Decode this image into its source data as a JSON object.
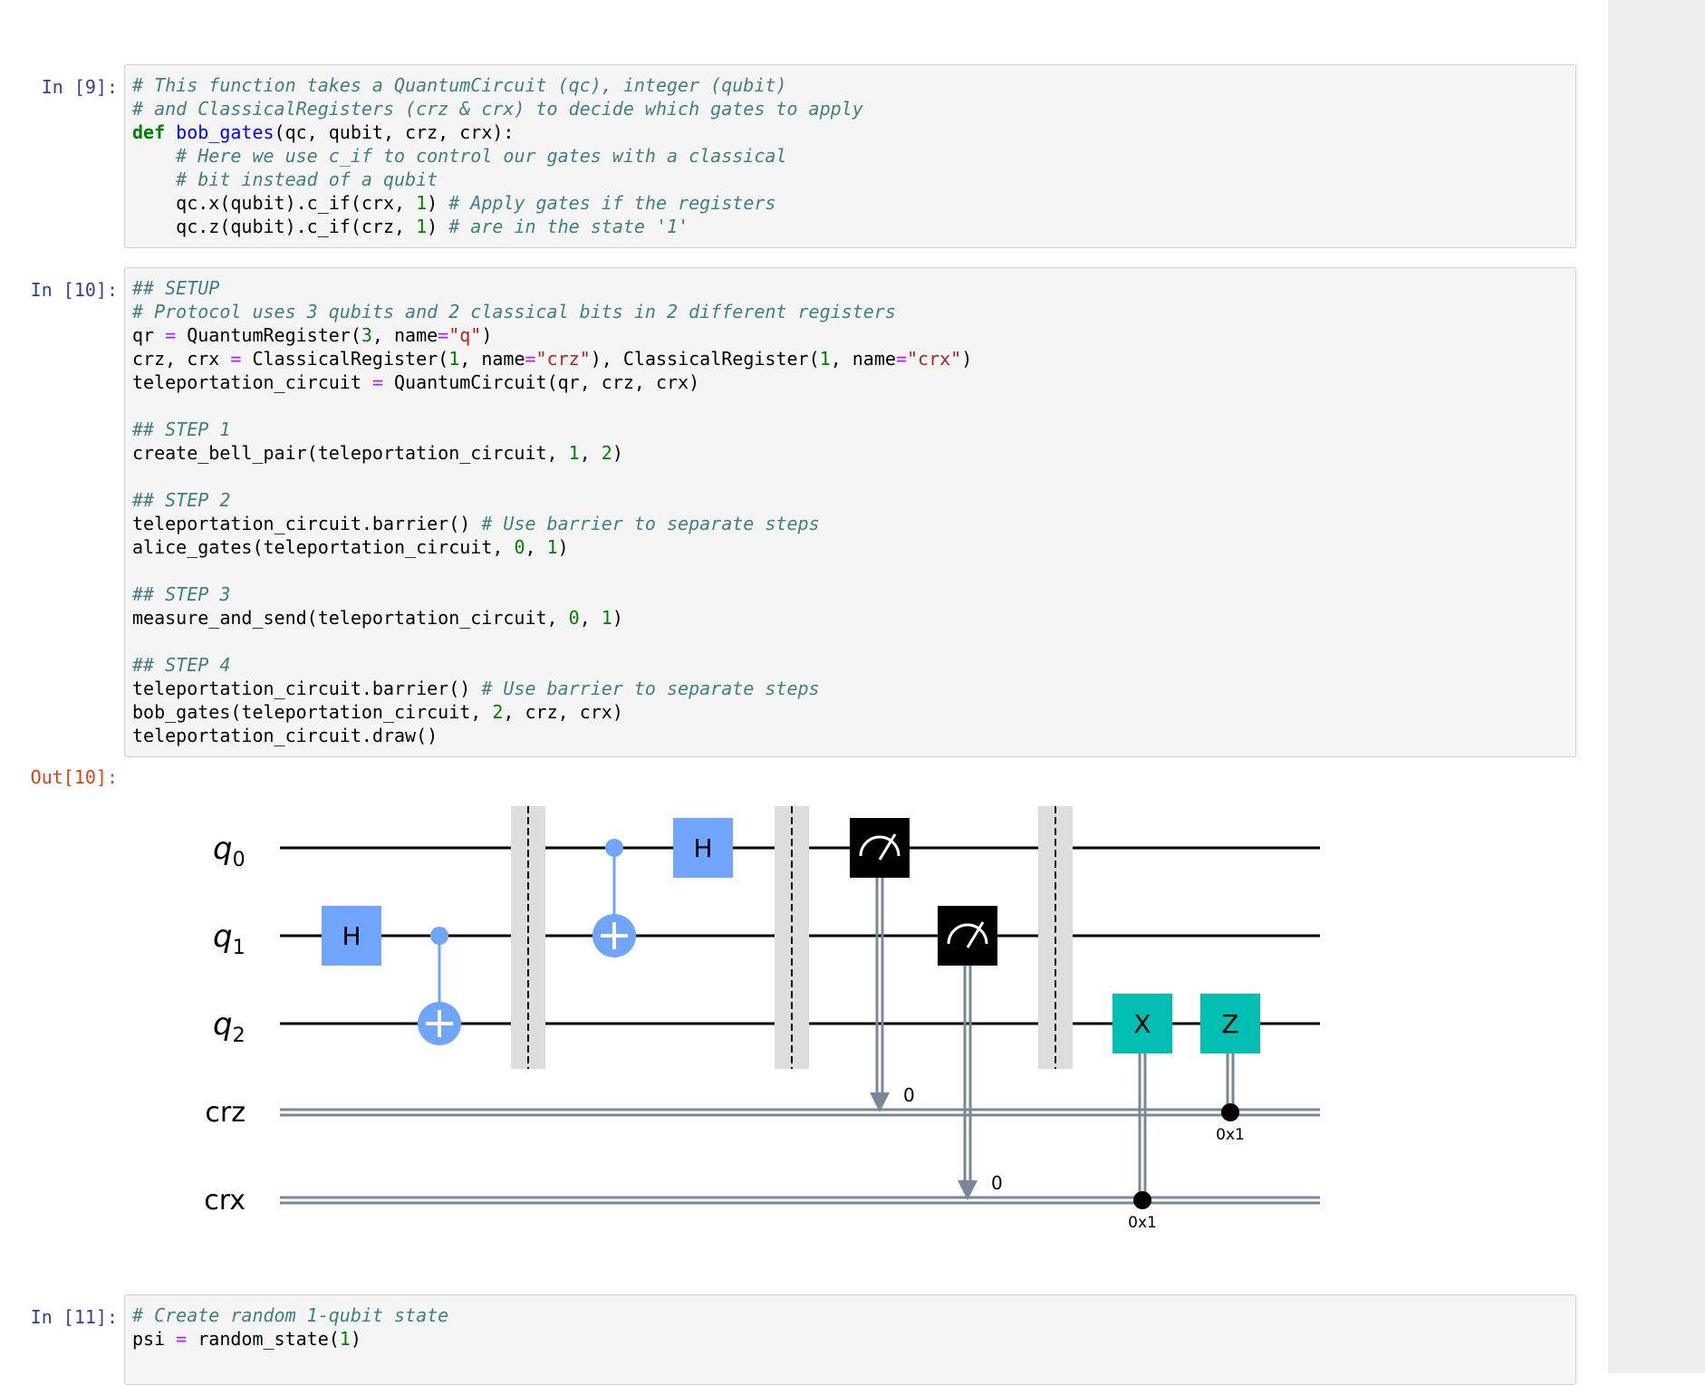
{
  "cells": [
    {
      "prompt": "In [9]:",
      "lines": [
        [
          {
            "t": "c",
            "v": "# This function takes a QuantumCircuit (qc), integer (qubit)"
          }
        ],
        [
          {
            "t": "c",
            "v": "# and ClassicalRegisters (crz & crx) to decide which gates to apply"
          }
        ],
        [
          {
            "t": "k",
            "v": "def"
          },
          {
            "t": "p",
            "v": " "
          },
          {
            "t": "nf",
            "v": "bob_gates"
          },
          {
            "t": "p",
            "v": "(qc, qubit, crz, crx):"
          }
        ],
        [
          {
            "t": "p",
            "v": "    "
          },
          {
            "t": "c",
            "v": "# Here we use c_if to control our gates with a classical"
          }
        ],
        [
          {
            "t": "p",
            "v": "    "
          },
          {
            "t": "c",
            "v": "# bit instead of a qubit"
          }
        ],
        [
          {
            "t": "p",
            "v": "    qc.x(qubit).c_if(crx, "
          },
          {
            "t": "mi",
            "v": "1"
          },
          {
            "t": "p",
            "v": ") "
          },
          {
            "t": "c",
            "v": "# Apply gates if the registers"
          }
        ],
        [
          {
            "t": "p",
            "v": "    qc.z(qubit).c_if(crz, "
          },
          {
            "t": "mi",
            "v": "1"
          },
          {
            "t": "p",
            "v": ") "
          },
          {
            "t": "c",
            "v": "# are in the state '1'"
          }
        ]
      ]
    },
    {
      "prompt": "In [10]:",
      "lines": [
        [
          {
            "t": "c",
            "v": "## SETUP"
          }
        ],
        [
          {
            "t": "c",
            "v": "# Protocol uses 3 qubits and 2 classical bits in 2 different registers"
          }
        ],
        [
          {
            "t": "p",
            "v": "qr "
          },
          {
            "t": "o",
            "v": "="
          },
          {
            "t": "p",
            "v": " QuantumRegister("
          },
          {
            "t": "mi",
            "v": "3"
          },
          {
            "t": "p",
            "v": ", name"
          },
          {
            "t": "o",
            "v": "="
          },
          {
            "t": "s",
            "v": "\"q\""
          },
          {
            "t": "p",
            "v": ")"
          }
        ],
        [
          {
            "t": "p",
            "v": "crz, crx "
          },
          {
            "t": "o",
            "v": "="
          },
          {
            "t": "p",
            "v": " ClassicalRegister("
          },
          {
            "t": "mi",
            "v": "1"
          },
          {
            "t": "p",
            "v": ", name"
          },
          {
            "t": "o",
            "v": "="
          },
          {
            "t": "s",
            "v": "\"crz\""
          },
          {
            "t": "p",
            "v": "), ClassicalRegister("
          },
          {
            "t": "mi",
            "v": "1"
          },
          {
            "t": "p",
            "v": ", name"
          },
          {
            "t": "o",
            "v": "="
          },
          {
            "t": "s",
            "v": "\"crx\""
          },
          {
            "t": "p",
            "v": ")"
          }
        ],
        [
          {
            "t": "p",
            "v": "teleportation_circuit "
          },
          {
            "t": "o",
            "v": "="
          },
          {
            "t": "p",
            "v": " QuantumCircuit(qr, crz, crx)"
          }
        ],
        [],
        [
          {
            "t": "c",
            "v": "## STEP 1"
          }
        ],
        [
          {
            "t": "p",
            "v": "create_bell_pair(teleportation_circuit, "
          },
          {
            "t": "mi",
            "v": "1"
          },
          {
            "t": "p",
            "v": ", "
          },
          {
            "t": "mi",
            "v": "2"
          },
          {
            "t": "p",
            "v": ")"
          }
        ],
        [],
        [
          {
            "t": "c",
            "v": "## STEP 2"
          }
        ],
        [
          {
            "t": "p",
            "v": "teleportation_circuit.barrier() "
          },
          {
            "t": "c",
            "v": "# Use barrier to separate steps"
          }
        ],
        [
          {
            "t": "p",
            "v": "alice_gates(teleportation_circuit, "
          },
          {
            "t": "mi",
            "v": "0"
          },
          {
            "t": "p",
            "v": ", "
          },
          {
            "t": "mi",
            "v": "1"
          },
          {
            "t": "p",
            "v": ")"
          }
        ],
        [],
        [
          {
            "t": "c",
            "v": "## STEP 3"
          }
        ],
        [
          {
            "t": "p",
            "v": "measure_and_send(teleportation_circuit, "
          },
          {
            "t": "mi",
            "v": "0"
          },
          {
            "t": "p",
            "v": ", "
          },
          {
            "t": "mi",
            "v": "1"
          },
          {
            "t": "p",
            "v": ")"
          }
        ],
        [],
        [
          {
            "t": "c",
            "v": "## STEP 4"
          }
        ],
        [
          {
            "t": "p",
            "v": "teleportation_circuit.barrier() "
          },
          {
            "t": "c",
            "v": "# Use barrier to separate steps"
          }
        ],
        [
          {
            "t": "p",
            "v": "bob_gates(teleportation_circuit, "
          },
          {
            "t": "mi",
            "v": "2"
          },
          {
            "t": "p",
            "v": ", crz, crx)"
          }
        ],
        [
          {
            "t": "p",
            "v": "teleportation_circuit.draw()"
          }
        ]
      ]
    },
    {
      "prompt": "In [11]:",
      "lines": [
        [
          {
            "t": "c",
            "v": "# Create random 1-qubit state"
          }
        ],
        [
          {
            "t": "p",
            "v": "psi "
          },
          {
            "t": "o",
            "v": "="
          },
          {
            "t": "p",
            "v": " random_state("
          },
          {
            "t": "mi",
            "v": "1"
          },
          {
            "t": "p",
            "v": ")"
          }
        ]
      ]
    }
  ],
  "output": {
    "prompt": "Out[10]:",
    "circuit": {
      "qubit_wires": [
        {
          "base": "q",
          "sub": "0"
        },
        {
          "base": "q",
          "sub": "1"
        },
        {
          "base": "q",
          "sub": "2"
        }
      ],
      "classical_wires": [
        "crz",
        "crx"
      ],
      "gates": {
        "h": "H",
        "x": "X",
        "z": "Z"
      },
      "measure_bits": [
        "0",
        "0"
      ],
      "condition_values": [
        "0x1",
        "0x1"
      ]
    },
    "colors": {
      "hadamard": "#6fa4ff",
      "control": "#6fa4ff",
      "classical_gate": "#00bfb2",
      "measure": "#000000",
      "classical_wire": "#778899",
      "barrier": "#dddddd"
    }
  }
}
